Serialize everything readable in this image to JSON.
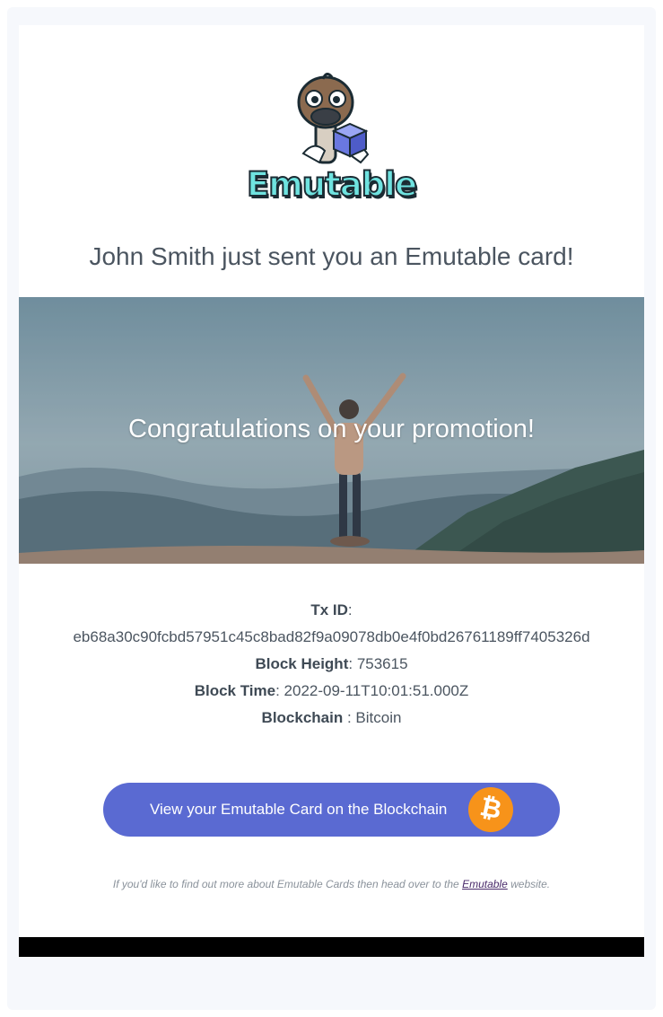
{
  "email": {
    "logo_text": "Emutable",
    "headline": "John Smith just sent you an Emutable card!",
    "hero_message": "Congratulations on your promotion!",
    "details": {
      "tx_id_label": "Tx ID",
      "tx_id_value": "eb68a30c90fcbd57951c45c8bad82f9a09078db0e4f0bd26761189ff7405326d",
      "block_height_label": "Block Height",
      "block_height_value": "753615",
      "block_time_label": "Block Time",
      "block_time_value": "2022-09-11T10:01:51.000Z",
      "blockchain_label": "Blockchain",
      "blockchain_value": "Bitcoin"
    },
    "cta_label": "View your Emutable Card on the Blockchain",
    "cta_icon": "bitcoin-icon",
    "footer": {
      "text_before": "If you'd like to find out more about Emutable Cards then head over to the",
      "link_text": "Emutable",
      "text_after": "website."
    }
  },
  "colors": {
    "page_background": "#f6f8fc",
    "card_background": "#ffffff",
    "button_background": "#5a6ad2",
    "bitcoin_orange": "#f7931a",
    "logo_cyan": "#6fe3e0",
    "heading_text": "#4b5560"
  }
}
